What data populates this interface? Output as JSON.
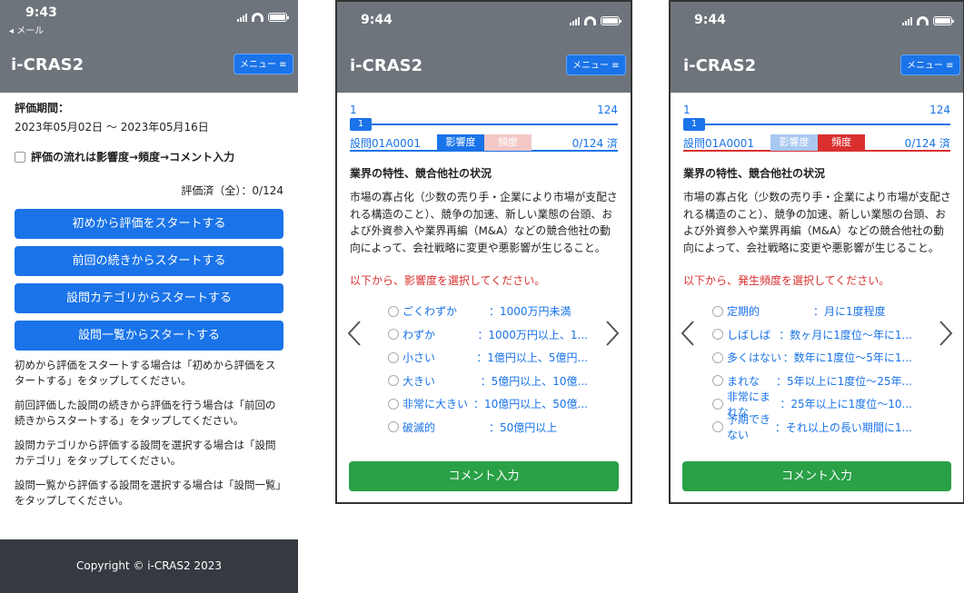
{
  "colors": {
    "header": "#6e747b",
    "primary": "#1a73e8",
    "danger": "#d9302f",
    "success": "#2aa047",
    "footer": "#343a40"
  },
  "phone1": {
    "time": "9:43",
    "back_label": "◂ メール",
    "brand": "i-CRAS2",
    "menu_label": "メニュー ≡",
    "period_label": "評価期間：",
    "period_value": "2023年05月02日 〜 2023年05月16日",
    "checkbox_label": "評価の流れは影響度→頻度→コメント入力",
    "done_label": "評価済（全）：0/124",
    "buttons": [
      "初めから評価をスタートする",
      "前回の続きからスタートする",
      "設問カテゴリからスタートする",
      "設問一覧からスタートする"
    ],
    "paragraphs": [
      "初めから評価をスタートする場合は「初めから評価をスタートする」をタップしてください。",
      "前回評価した設問の続きから評価を行う場合は「前回の続きからスタートする」をタップしてください。",
      "設問カテゴリから評価する設問を選択する場合は「設問カテゴリ」をタップしてください。",
      "設問一覧から評価する設問を選択する場合は「設問一覧」をタップしてください。"
    ],
    "footer": "Copyright © i-CRAS2 2023"
  },
  "phone2": {
    "time": "9:44",
    "brand": "i-CRAS2",
    "menu_label": "メニュー ≡",
    "prog_start": "1",
    "prog_end": "124",
    "knob": "1",
    "question_id": "設問01A0001",
    "tab_impact": "影響度",
    "tab_freq": "頻度",
    "count": "0/124 済",
    "section": "業界の特性、競合他社の状況",
    "description": "市場の寡占化（少数の売り手・企業により市場が支配される構造のこと）、競争の加速、新しい業態の台頭、および外資参入や業界再編（M&A）などの競合他社の動向によって、会社戦略に変更や悪影響が生じること。",
    "prompt": "以下から、影響度を選択してください。",
    "options": [
      {
        "label": "ごくわずか",
        "value": "：1000万円未満"
      },
      {
        "label": "わずか",
        "value": "：1000万円以上、1..."
      },
      {
        "label": "小さい",
        "value": "：1億円以上、5億円..."
      },
      {
        "label": "大きい",
        "value": "：5億円以上、10億..."
      },
      {
        "label": "非常に大きい",
        "value": "：10億円以上、50億..."
      },
      {
        "label": "破滅的",
        "value": "：50億円以上"
      }
    ],
    "comment_button": "コメント入力"
  },
  "phone3": {
    "time": "9:44",
    "brand": "i-CRAS2",
    "menu_label": "メニュー ≡",
    "prog_start": "1",
    "prog_end": "124",
    "knob": "1",
    "question_id": "設問01A0001",
    "tab_impact": "影響度",
    "tab_freq": "頻度",
    "count": "0/124 済",
    "section": "業界の特性、競合他社の状況",
    "description": "市場の寡占化（少数の売り手・企業により市場が支配される構造のこと）、競争の加速、新しい業態の台頭、および外資参入や業界再編（M&A）などの競合他社の動向によって、会社戦略に変更や悪影響が生じること。",
    "prompt": "以下から、発生頻度を選択してください。",
    "options": [
      {
        "label": "定期的",
        "value": "：月に1度程度"
      },
      {
        "label": "しばしば",
        "value": "：数ヶ月に1度位〜年に1..."
      },
      {
        "label": "多くはない",
        "value": "：数年に1度位〜5年に1..."
      },
      {
        "label": "まれな",
        "value": "：5年以上に1度位〜25年..."
      },
      {
        "label": "非常にまれな",
        "value": "：25年以上に1度位〜10..."
      },
      {
        "label": "予期できない",
        "value": "：それ以上の長い期間に1..."
      }
    ],
    "comment_button": "コメント入力"
  }
}
